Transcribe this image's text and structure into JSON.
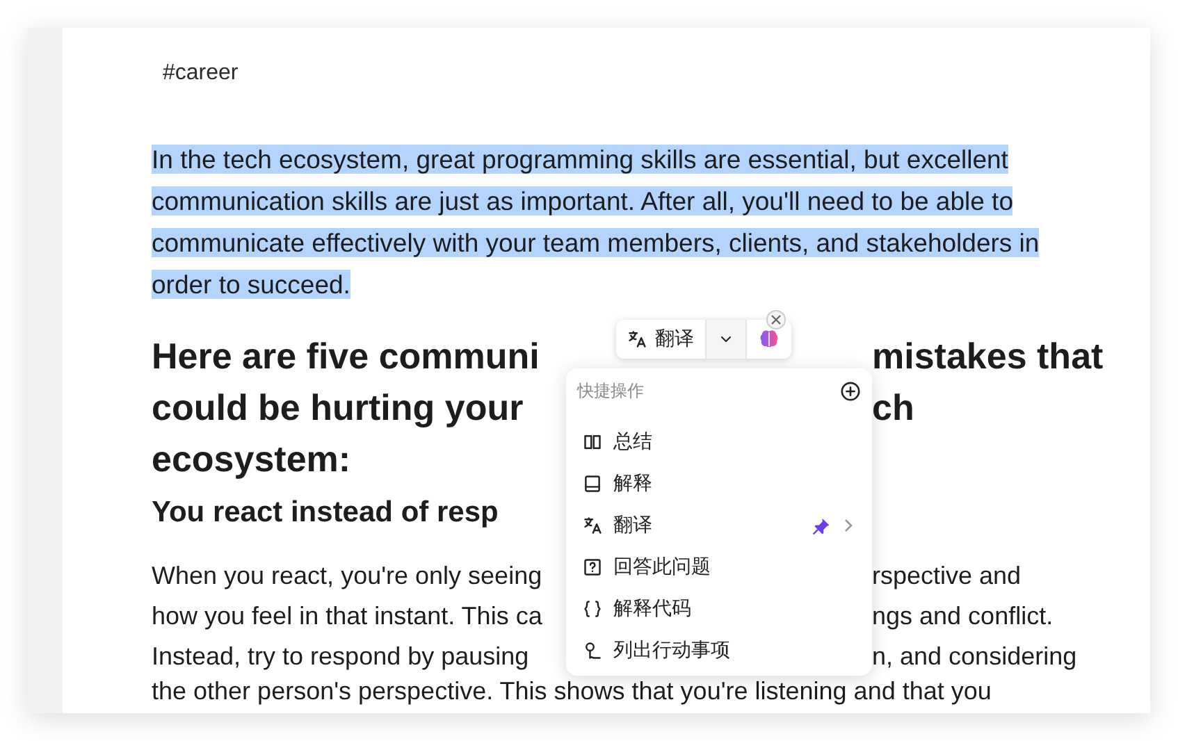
{
  "tag": "#career",
  "selected_paragraph": {
    "selected": true,
    "text": "In the tech ecosystem, great programming skills are essential, but excellent communication skills are just as important. After all, you'll need to be able to communicate effectively with your team members, clients, and stakeholders in order to succeed."
  },
  "heading": {
    "lines": [
      {
        "left": "Here are five communi",
        "right": "mistakes that"
      },
      {
        "left": "could be hurting your",
        "right": "ch"
      },
      {
        "left": "ecosystem:"
      }
    ]
  },
  "subheading": {
    "lines": [
      {
        "left": "You react instead of resp"
      }
    ]
  },
  "body": {
    "lines": [
      {
        "left": "When you react, you're only seeing",
        "right": "rspective and"
      },
      {
        "left": "how you feel in that instant. This ca",
        "right": "ngs and conflict."
      },
      {
        "left": "Instead, try to respond by pausing",
        "right": "n, and considering"
      },
      {
        "left": "the other person's perspective. This shows that you're listening and that you"
      }
    ]
  },
  "toolbar": {
    "action": "翻译"
  },
  "menu": {
    "title": "快捷操作",
    "items": [
      {
        "label": "总结",
        "pinned": false,
        "submenu": false
      },
      {
        "label": "解释",
        "pinned": false,
        "submenu": false
      },
      {
        "label": "翻译",
        "pinned": true,
        "submenu": true
      },
      {
        "label": "回答此问题",
        "pinned": false,
        "submenu": false
      },
      {
        "label": "解释代码",
        "pinned": false,
        "submenu": false
      },
      {
        "label": "列出行动事项",
        "pinned": false,
        "submenu": false
      }
    ]
  }
}
